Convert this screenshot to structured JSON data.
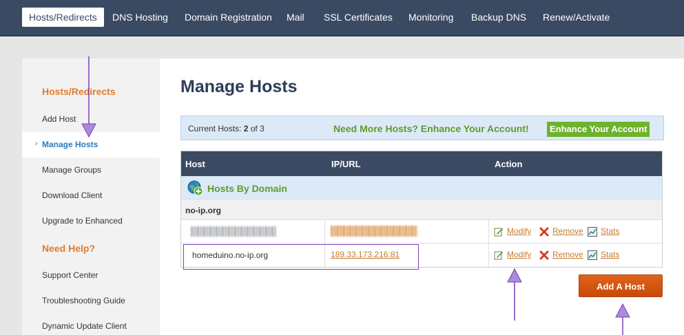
{
  "topnav": {
    "tabs": [
      {
        "label": "Hosts/Redirects",
        "active": true
      },
      {
        "label": "DNS Hosting"
      },
      {
        "label": "Domain Registration"
      },
      {
        "label": "Mail"
      },
      {
        "label": "SSL Certificates"
      },
      {
        "label": "Monitoring"
      },
      {
        "label": "Backup DNS"
      },
      {
        "label": "Renew/Activate"
      }
    ]
  },
  "sidebar": {
    "section1_title": "Hosts/Redirects",
    "items": [
      "Add Host",
      "Manage Hosts",
      "Manage Groups",
      "Download Client",
      "Upgrade to Enhanced"
    ],
    "selected": "Manage Hosts",
    "section2_title": "Need Help?",
    "help_items": [
      "Support Center",
      "Troubleshooting Guide",
      "Dynamic Update Client"
    ]
  },
  "main": {
    "title": "Manage Hosts",
    "current_hosts_label": "Current Hosts:",
    "current_hosts_value": "2",
    "current_hosts_total": "of 3",
    "promo_text": "Need More Hosts? Enhance Your Account!",
    "enhance_button": "Enhance Your Account",
    "table": {
      "columns": [
        "Host",
        "IP/URL",
        "Action"
      ],
      "group_label": "Hosts By Domain",
      "domain": "no-ip.org",
      "rows": [
        {
          "host": "",
          "ip": "",
          "redacted": true
        },
        {
          "host": "homeduino.no-ip.org",
          "ip": "189.33.173.216:81"
        }
      ],
      "actions": [
        "Modify",
        "Remove",
        "Stats"
      ]
    },
    "add_button": "Add A Host"
  },
  "colors": {
    "nav_bg": "#3b4a63",
    "accent_orange": "#e07b2b",
    "accent_green": "#6eb22d",
    "link": "#c97a2a",
    "annotation": "#7b3fb5"
  }
}
